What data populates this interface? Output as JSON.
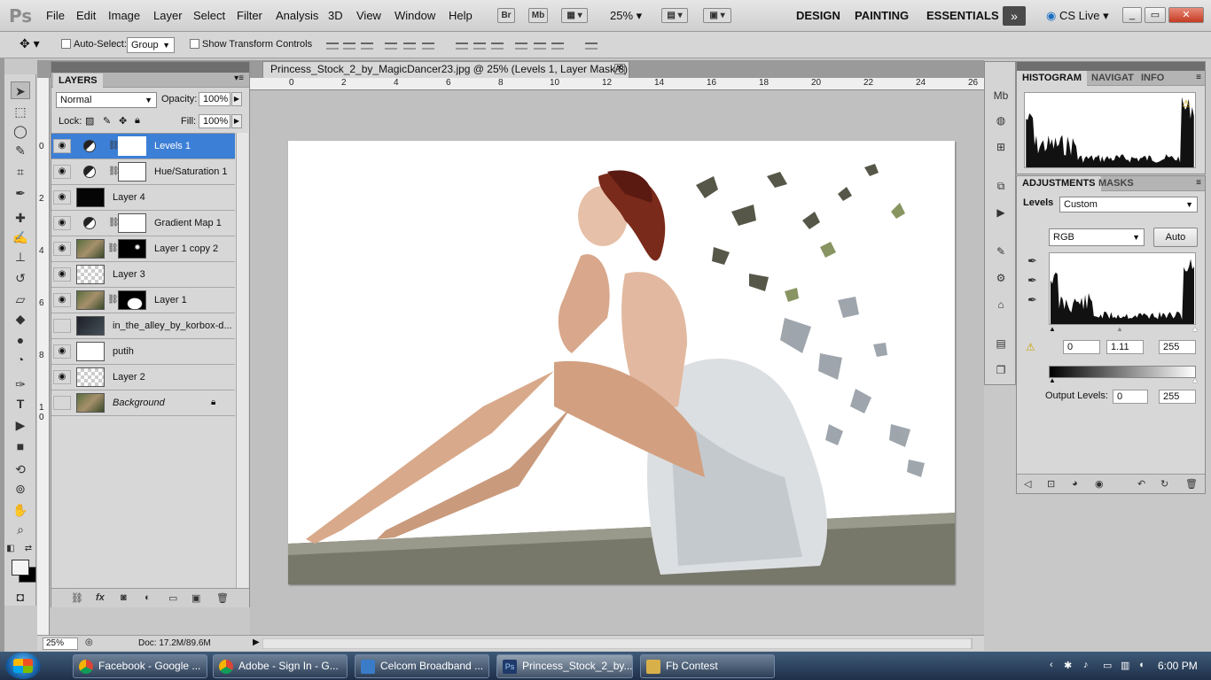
{
  "app": {
    "logo": "Ps",
    "menus": [
      "File",
      "Edit",
      "Image",
      "Layer",
      "Select",
      "Filter",
      "Analysis",
      "3D",
      "View",
      "Window",
      "Help"
    ],
    "bridge_btn": "Br",
    "minibridge_btn": "Mb",
    "zoom_dropdown": "25%",
    "workspaces": [
      "DESIGN",
      "PAINTING",
      "ESSENTIALS"
    ],
    "more": "»",
    "cslive": "CS Live",
    "win_min": "_",
    "win_max": "▭",
    "win_close": "✕"
  },
  "options": {
    "auto_select_label": "Auto-Select:",
    "auto_select_value": "Group",
    "show_transform_label": "Show Transform Controls"
  },
  "document": {
    "tab_title": "Princess_Stock_2_by_MagicDancer23.jpg @ 25% (Levels 1, Layer Mask/8) *",
    "ruler_h": [
      "0",
      "2",
      "4",
      "6",
      "8",
      "10",
      "12",
      "14",
      "16",
      "18",
      "20",
      "22",
      "24",
      "26"
    ],
    "ruler_v": [
      "0",
      "2",
      "4",
      "6",
      "8",
      "1 0"
    ]
  },
  "status": {
    "zoom": "25%",
    "doc": "Doc: 17.2M/89.6M"
  },
  "layers_panel": {
    "tab": "LAYERS",
    "blend_mode": "Normal",
    "opacity_label": "Opacity:",
    "opacity_value": "100%",
    "lock_label": "Lock:",
    "fill_label": "Fill:",
    "fill_value": "100%",
    "layers": [
      {
        "name": "Levels 1",
        "selected": true,
        "visible": true,
        "kind": "adjustment",
        "thumb": "white"
      },
      {
        "name": "Hue/Saturation 1",
        "selected": false,
        "visible": true,
        "kind": "adjustment",
        "thumb": "white"
      },
      {
        "name": "Layer 4",
        "selected": false,
        "visible": true,
        "kind": "pixel",
        "thumb": "black"
      },
      {
        "name": "Gradient Map 1",
        "selected": false,
        "visible": true,
        "kind": "adjustment",
        "thumb": "white"
      },
      {
        "name": "Layer 1 copy 2",
        "selected": false,
        "visible": true,
        "kind": "masked",
        "thumb": "photo",
        "mask": "masksplat"
      },
      {
        "name": "Layer 3",
        "selected": false,
        "visible": true,
        "kind": "pixel",
        "thumb": "trans"
      },
      {
        "name": "Layer 1",
        "selected": false,
        "visible": true,
        "kind": "masked",
        "thumb": "photo",
        "mask": "maskfig"
      },
      {
        "name": "in_the_alley_by_korbox-d...",
        "selected": false,
        "visible": false,
        "kind": "smart",
        "thumb": "dark"
      },
      {
        "name": "putih",
        "selected": false,
        "visible": true,
        "kind": "pixel",
        "thumb": "white"
      },
      {
        "name": "Layer 2",
        "selected": false,
        "visible": true,
        "kind": "pixel",
        "thumb": "trans"
      },
      {
        "name": "Background",
        "selected": false,
        "visible": false,
        "kind": "background",
        "thumb": "photo"
      }
    ]
  },
  "histogram_panel": {
    "tabs": [
      "HISTOGRAM",
      "NAVIGAT",
      "INFO"
    ]
  },
  "adjustments_panel": {
    "tabs": [
      "ADJUSTMENTS",
      "MASKS"
    ],
    "type_label": "Levels",
    "preset": "Custom",
    "channel": "RGB",
    "auto_btn": "Auto",
    "input_black": "0",
    "input_gamma": "1.11",
    "input_white": "255",
    "output_label": "Output Levels:",
    "output_black": "0",
    "output_white": "255"
  },
  "taskbar": {
    "tasks": [
      {
        "label": "Facebook - Google ...",
        "color": "#e04a3a"
      },
      {
        "label": "Adobe - Sign In - G...",
        "color": "#e04a3a"
      },
      {
        "label": "Celcom Broadband ...",
        "color": "#3a7cc8"
      },
      {
        "label": "Princess_Stock_2_by...",
        "color": "#1f3a6a"
      },
      {
        "label": "Fb Contest",
        "color": "#d8b04a"
      }
    ],
    "clock": "6:00 PM"
  },
  "colors": {
    "selection": "#3c7fd6",
    "panel": "#d7d7d7",
    "canvas_bg": "#c0c0c0"
  }
}
